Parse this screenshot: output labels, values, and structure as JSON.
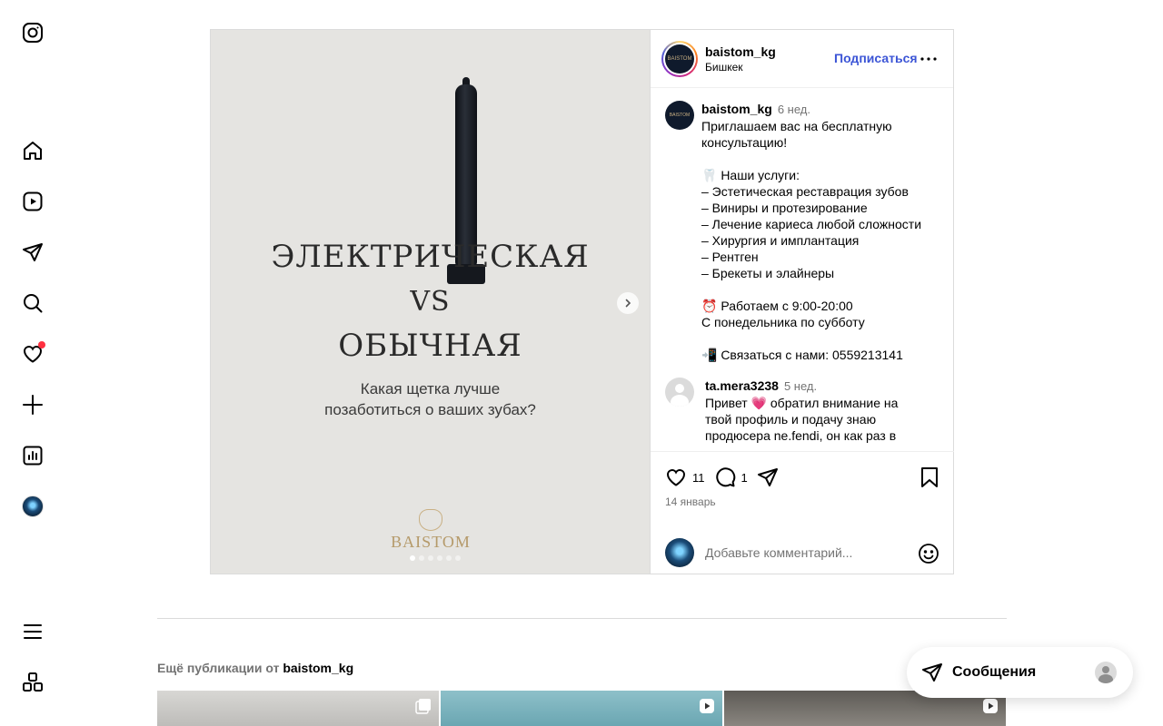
{
  "nav": {
    "items": [
      "home",
      "reels",
      "direct",
      "search",
      "notifications",
      "create",
      "dashboard",
      "profile"
    ],
    "bottom": [
      "menu",
      "also-from-meta"
    ]
  },
  "post": {
    "image": {
      "headline_1": "ЭЛЕКТРИЧЕСКАЯ",
      "headline_2": "VS",
      "headline_3": "ОБЫЧНАЯ",
      "subtitle": "Какая щетка лучше\nпозаботиться о ваших зубах?",
      "brand": "BAISTOM",
      "carousel_total": 6,
      "carousel_index": 1
    },
    "header": {
      "username": "baistom_kg",
      "location": "Бишкек",
      "follow_label": "Подписаться",
      "brand_avatar_text": "BAISTOM"
    },
    "caption": {
      "username": "baistom_kg",
      "time": "6 нед.",
      "text": "Приглашаем вас на бесплатную консультацию!\n\n🦷  Наши услуги:\n– Эстетическая реставрация зубов\n– Виниры и протезирование\n– Лечение кариеса любой сложности\n– Хирургия и имплантация\n– Рентген\n– Брекеты и элайнеры\n\n⏰  Работаем с 9:00-20:00\nС понедельника по субботу\n\n📲  Связаться с нами: 0559213141"
    },
    "comments": [
      {
        "username": "ta.mera3238",
        "time": "5 нед.",
        "text": "Привет 💗 обратил внимание на твой профиль и подачу знаю продюсера ne.fendi, он как раз в"
      }
    ],
    "likes": "11",
    "comment_count": "1",
    "date": "14 январь",
    "add_comment_placeholder": "Добавьте комментарий..."
  },
  "more_from": {
    "prefix": "Ещё публикации от",
    "username": "baistom_kg"
  },
  "messages": {
    "label": "Сообщения"
  },
  "colors": {
    "accent": "#3c55d6",
    "notification": "#ff3040",
    "border": "#dbdbdb",
    "muted": "#737373"
  }
}
